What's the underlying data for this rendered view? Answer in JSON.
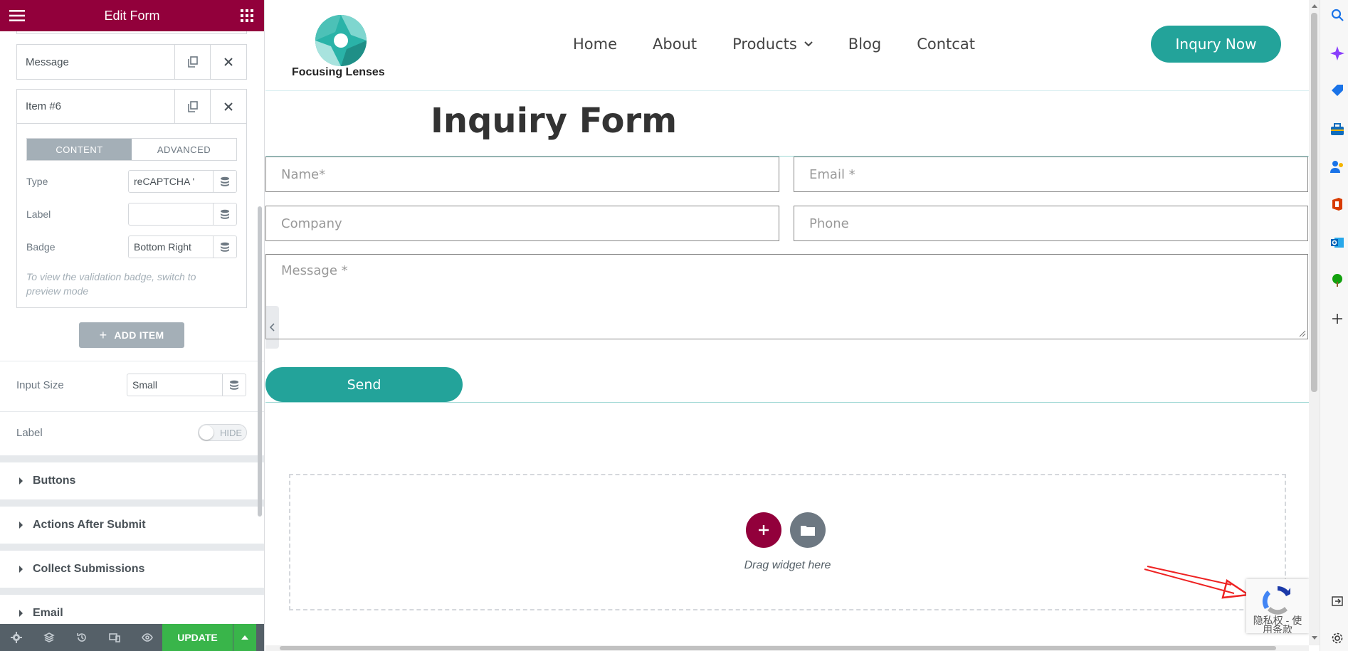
{
  "panel": {
    "title": "Edit Form",
    "items": [
      {
        "label": "Message"
      },
      {
        "label": "Item #6"
      }
    ],
    "tabs": {
      "content": "CONTENT",
      "advanced": "ADVANCED"
    },
    "fields": {
      "type_label": "Type",
      "type_value": "reCAPTCHA '",
      "label_label": "Label",
      "label_value": "",
      "badge_label": "Badge",
      "badge_value": "Bottom Right"
    },
    "note": "To view the validation badge, switch to preview mode",
    "add_item": "ADD ITEM",
    "input_size_label": "Input Size",
    "input_size_value": "Small",
    "label_toggle_label": "Label",
    "label_toggle_state": "HIDE",
    "sections": [
      "Buttons",
      "Actions After Submit",
      "Collect Submissions",
      "Email"
    ],
    "footer": {
      "update": "UPDATE"
    }
  },
  "site": {
    "logo_text": "Focusing Lenses",
    "nav": [
      "Home",
      "About",
      "Products",
      "Blog",
      "Contcat"
    ],
    "cta": "Inqury Now",
    "colors": {
      "accent": "#23a39a",
      "elementor": "#92003b"
    }
  },
  "form": {
    "title": "Inquiry Form",
    "placeholders": {
      "name": "Name*",
      "email": "Email *",
      "company": "Company",
      "phone": "Phone",
      "message": "Message *"
    },
    "submit": "Send"
  },
  "dropzone": {
    "text": "Drag widget here"
  },
  "recaptcha": {
    "text_line1": "隐私权 - 使",
    "text_line2": "用条款"
  }
}
